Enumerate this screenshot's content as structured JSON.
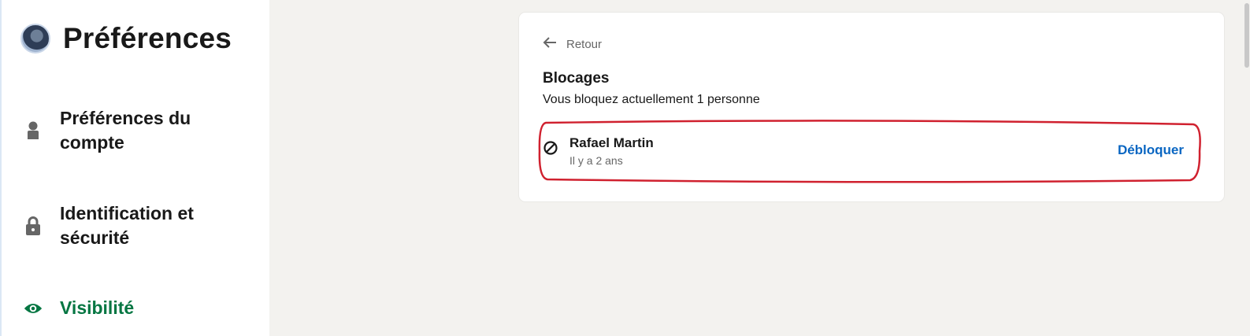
{
  "sidebar": {
    "title": "Préférences",
    "avatar_icon": "avatar",
    "items": [
      {
        "label": "Préférences du compte",
        "icon": "person-icon",
        "active": false
      },
      {
        "label": "Identification et sécurité",
        "icon": "lock-icon",
        "active": false
      },
      {
        "label": "Visibilité",
        "icon": "eye-icon",
        "active": true
      }
    ]
  },
  "main": {
    "back_label": "Retour",
    "section_title": "Blocages",
    "section_subtitle": "Vous bloquez actuellement 1 personne",
    "blocked_people": [
      {
        "name": "Rafael Martin",
        "time": "Il y a 2 ans",
        "action_label": "Débloquer",
        "icon": "block-icon"
      }
    ]
  },
  "colors": {
    "active_nav": "#057642",
    "link": "#0a66c2",
    "highlight": "#d0212f",
    "background": "#f3f2ef"
  }
}
